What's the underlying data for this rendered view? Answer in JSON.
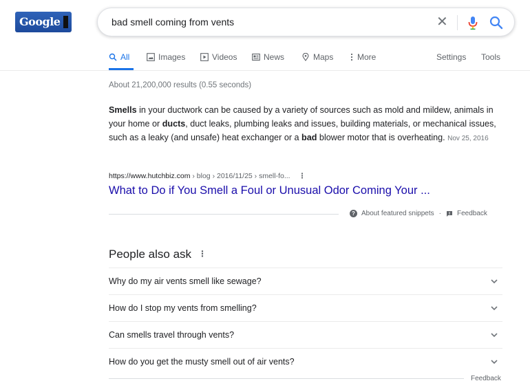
{
  "logo": {
    "text": "Google"
  },
  "search": {
    "query": "bad smell coming from vents",
    "clear_icon": "close-icon",
    "voice_icon": "mic-icon",
    "search_icon": "search-icon"
  },
  "tabs": [
    {
      "label": "All",
      "icon": "search-icon",
      "active": true
    },
    {
      "label": "Images",
      "icon": "image-icon"
    },
    {
      "label": "Videos",
      "icon": "video-icon"
    },
    {
      "label": "News",
      "icon": "news-icon"
    },
    {
      "label": "Maps",
      "icon": "map-pin-icon"
    },
    {
      "label": "More",
      "icon": "more-vert-icon"
    }
  ],
  "tools": {
    "settings": "Settings",
    "tools": "Tools"
  },
  "stats": "About 21,200,000 results (0.55 seconds)",
  "snippet": {
    "segments": [
      {
        "text": "Smells",
        "bold": true
      },
      {
        "text": " in your ductwork can be caused by a variety of sources such as mold and mildew, animals in your home or ",
        "bold": false
      },
      {
        "text": "ducts",
        "bold": true
      },
      {
        "text": ", duct leaks, plumbing leaks and issues, building materials, or mechanical issues, such as a leaky (and unsafe) heat exchanger or a ",
        "bold": false
      },
      {
        "text": "bad",
        "bold": true
      },
      {
        "text": " blower motor that is overheating.",
        "bold": false
      }
    ],
    "date": "Nov 25, 2016"
  },
  "result": {
    "domain": "https://www.hutchbiz.com",
    "path": " › blog › 2016/11/25 › smell-fo...",
    "menu": "⋮",
    "title": "What to Do if You Smell a Foul or Unusual Odor Coming Your ..."
  },
  "featured_footer": {
    "about": "About featured snippets",
    "separator": "·",
    "feedback": "Feedback"
  },
  "paa": {
    "title": "People also ask",
    "menu": "⋮",
    "questions": [
      "Why do my air vents smell like sewage?",
      "How do I stop my vents from smelling?",
      "Can smells travel through vents?",
      "How do you get the musty smell out of air vents?"
    ],
    "feedback": "Feedback"
  },
  "colors": {
    "link": "#1a0dab",
    "accent": "#1a73e8",
    "muted": "#70757a"
  }
}
